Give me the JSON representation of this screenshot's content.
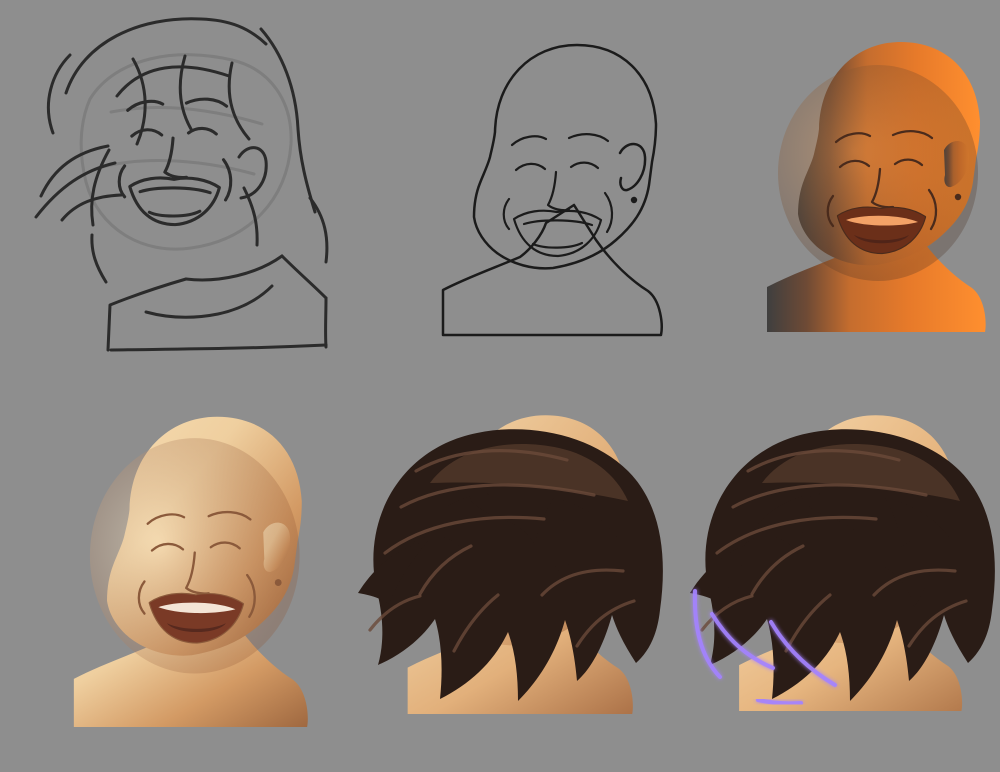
{
  "canvas": {
    "background": "#8e8e8e"
  },
  "steps": [
    {
      "id": "sketch",
      "icon": "rough-sketch-icon"
    },
    {
      "id": "lineart",
      "icon": "clean-lineart-icon"
    },
    {
      "id": "underpainting",
      "icon": "orange-underpainting-icon"
    },
    {
      "id": "skin-render",
      "icon": "skin-render-icon"
    },
    {
      "id": "hair-render",
      "icon": "hair-render-icon"
    },
    {
      "id": "rim-light-final",
      "icon": "rim-light-icon"
    }
  ],
  "palette": {
    "line": "#1b1b1b",
    "sketch": "#2b2b2b",
    "underpaint": "#e77a2a",
    "underpaint_dark": "#3f3f3f",
    "skin_light": "#efcf9f",
    "skin_mid": "#d39a64",
    "skin_shadow": "#9f6840",
    "hair_dark": "#2a1c16",
    "hair_mid": "#4a3326",
    "mouth": "#7a3a26",
    "teeth": "#f4e5d6",
    "rim_light": "#a483ff"
  }
}
